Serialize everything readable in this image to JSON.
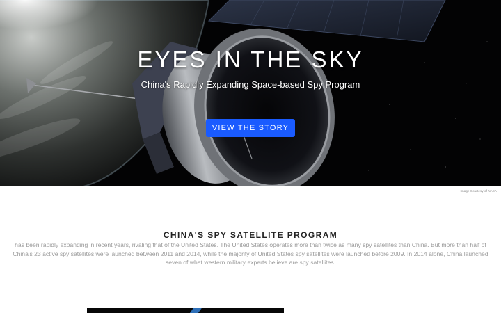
{
  "hero": {
    "title": "EYES IN THE SKY",
    "subtitle": "China's Rapidly Expanding Space-based Spy Program",
    "cta_label": "VIEW THE STORY",
    "image_credit": "Image Courtesy of NASA"
  },
  "section": {
    "title": "CHINA'S SPY SATELLITE PROGRAM",
    "body": "has been rapidly expanding in recent years, rivaling that of the United States. The United States operates more than twice as many spy satellites than China. But more than half of China's 23 active spy satellites were launched between 2011 and 2014, while the majority of United States spy satellites were launched before 2009. In 2014 alone, China launched seven of what western military experts believe are spy satellites."
  },
  "colors": {
    "cta_background": "#1a5bff",
    "hero_background": "#020203",
    "body_text": "#9a9a9a",
    "heading_text": "#222222"
  }
}
